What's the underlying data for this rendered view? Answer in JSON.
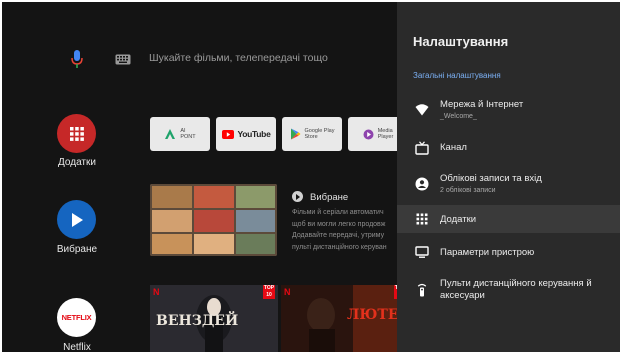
{
  "search": {
    "placeholder": "Шукайте фільми, телепередачі тощо"
  },
  "rail": {
    "apps_label": "Додатки",
    "favorites_label": "Вибране",
    "netflix_label": "Netflix",
    "netflix_logo": "NETFLIX"
  },
  "apps": [
    {
      "name": "AI PONT",
      "line1": "AI",
      "line2": "PONT"
    },
    {
      "name": "YouTube",
      "text": "YouTube"
    },
    {
      "name": "Google Play Store",
      "line1": "Google Play",
      "line2": "Store"
    },
    {
      "name": "Media Player",
      "line1": "Media",
      "line2": "Player"
    }
  ],
  "favorites": {
    "title": "Вибране",
    "description_lines": [
      "Фільми й серіали автоматич",
      "щоб ви могли легко продовж",
      "Додавайте передачі, утриму",
      "пульті дистанційного керуван"
    ]
  },
  "netflix_row": [
    {
      "title": "ВЕНЗДЕЙ",
      "badge_top": "TOP",
      "badge_num": "10"
    },
    {
      "title": "ЛЮТЕРО",
      "badge_top": "TOP",
      "badge_num": "10"
    }
  ],
  "settings": {
    "title": "Налаштування",
    "section": "Загальні налаштування",
    "items": [
      {
        "label": "Мережа й Інтернет",
        "sublabel": "_Welcome_",
        "icon": "wifi-icon"
      },
      {
        "label": "Канал",
        "icon": "tv-channel-icon"
      },
      {
        "label": "Облікові записи та вхід",
        "sublabel": "2 облікові записи",
        "icon": "account-icon"
      },
      {
        "label": "Додатки",
        "icon": "apps-grid-icon"
      },
      {
        "label": "Параметри пристрою",
        "icon": "display-icon"
      },
      {
        "label": "Пульти дистанційного керування й",
        "label2": "аксесуари",
        "icon": "remote-icon"
      }
    ]
  },
  "colors": {
    "background": "#141414",
    "panel": "#2a2a2a",
    "panel_highlight": "#3a3a3a",
    "section_accent": "#7cb1f5",
    "apps_circle": "#c62828",
    "favorites_circle": "#1565c0",
    "netflix_red": "#e50914"
  }
}
